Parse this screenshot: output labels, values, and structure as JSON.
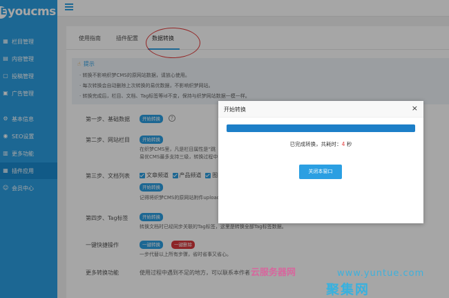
{
  "app": {
    "logo_letter": "E",
    "logo_text": "youcms"
  },
  "sidebar": {
    "items": [
      {
        "label": "栏目管理",
        "icon": "list-icon"
      },
      {
        "label": "内容管理",
        "icon": "grid-icon"
      },
      {
        "label": "投稿管理",
        "icon": "submit-icon"
      },
      {
        "label": "广告管理",
        "icon": "ad-icon"
      },
      {
        "label": "基本信息",
        "icon": "info-icon"
      },
      {
        "label": "SEO设置",
        "icon": "seo-icon"
      },
      {
        "label": "更多功能",
        "icon": "more-icon"
      },
      {
        "label": "插件应用",
        "icon": "plugin-icon",
        "active": true
      },
      {
        "label": "会员中心",
        "icon": "user-icon"
      }
    ]
  },
  "tabs": [
    {
      "label": "使用指南"
    },
    {
      "label": "插件配置"
    },
    {
      "label": "数据转换",
      "active": true
    }
  ],
  "tips": {
    "title": "提示",
    "lines": [
      "· 转换不影响织梦CMS的原网站数据，请放心使用。",
      "· 每次转换会自动删除上次转换的易优数据，不影响织梦网站。",
      "· 转换完成后，栏目、文档、Tag标签等id不变，保持与织梦网站数据一模一样。"
    ]
  },
  "steps": {
    "step1": {
      "label": "第一步、基础数据",
      "button": "开始转换",
      "hint": "?"
    },
    "step2": {
      "label": "第二步、网站栏目",
      "button": "开始转换",
      "note1": "在织梦CMS里，凡是栏目属性是“跳",
      "note2": "易优CMS最多支持三级，转换过程中"
    },
    "step3": {
      "label": "第三步、文档列表",
      "options": [
        "文章频道",
        "产品频道",
        "图"
      ],
      "button": "开始转换",
      "note": "记得将织梦CMS的原网站附件upload"
    },
    "step4": {
      "label": "第四步、Tag标签",
      "button": "开始转换",
      "note": "转换文档时已经同步关联的Tag标签，这里是转换全部Tag标签数据。"
    },
    "quick": {
      "label": "一键快捷操作",
      "convert_button": "一键转换",
      "delete_button": "一键删除",
      "note": "一步代替以上所有步骤，省时省事又省心。"
    },
    "more": {
      "label": "更多转换功能",
      "note": "使用过程中遇到不足的地方，可以联系本作者"
    }
  },
  "modal": {
    "title": "开始转换",
    "close": "×",
    "progress_percent": 100,
    "message_prefix": "已完成转换，共耗时：",
    "message_value": "4",
    "message_suffix": " 秒",
    "button": "关闭本窗口"
  },
  "watermark": {
    "line1": "云服务器网",
    "line2": "www.yuntue.com",
    "line3": "聚集网"
  },
  "colors": {
    "sidebar": "#2b9fe2",
    "sidebar_active": "#1b8bd0",
    "accent": "#2b9fe2",
    "progress": "#1d7fc8",
    "danger": "#d9383c",
    "highlight_circle": "#e23a3a"
  }
}
